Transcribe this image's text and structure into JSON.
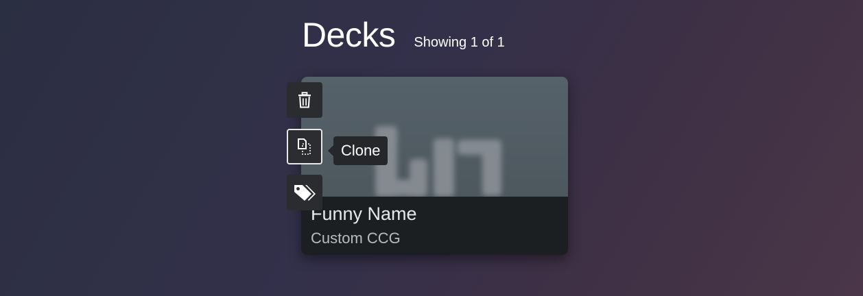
{
  "header": {
    "title": "Decks",
    "count_text": "Showing 1 of 1"
  },
  "deck": {
    "name": "Funny Name",
    "type": "Custom CCG"
  },
  "actions": {
    "delete_icon": "trash-icon",
    "clone_icon": "clone-icon",
    "tags_icon": "tags-icon",
    "tooltip": "Clone"
  },
  "colors": {
    "button_bg": "#2a2c2f",
    "tooltip_bg": "#25272a",
    "card_info_bg": "#1c1f21"
  }
}
